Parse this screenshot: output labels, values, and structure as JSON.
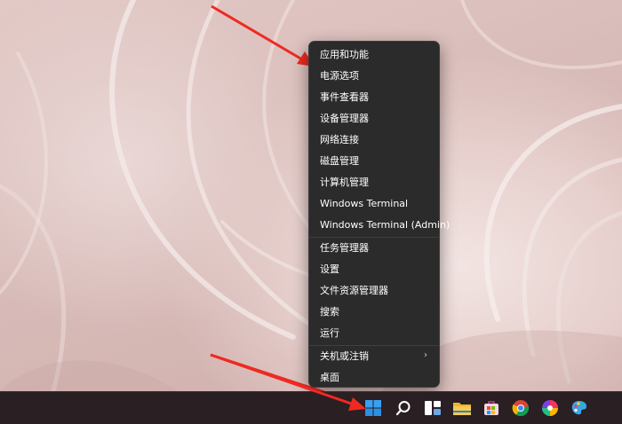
{
  "context_menu": {
    "items": [
      {
        "label": "应用和功能"
      },
      {
        "label": "电源选项"
      },
      {
        "label": "事件查看器"
      },
      {
        "label": "设备管理器"
      },
      {
        "label": "网络连接"
      },
      {
        "label": "磁盘管理"
      },
      {
        "label": "计算机管理"
      },
      {
        "label": "Windows Terminal"
      },
      {
        "label": "Windows Terminal (Admin)"
      },
      {
        "label": "任务管理器"
      },
      {
        "label": "设置"
      },
      {
        "label": "文件资源管理器"
      },
      {
        "label": "搜索"
      },
      {
        "label": "运行"
      },
      {
        "label": "关机或注销",
        "submenu_indicator": "›"
      },
      {
        "label": "桌面"
      }
    ]
  },
  "taskbar": {
    "icons": [
      "start-icon",
      "search-icon",
      "task-view-icon",
      "file-explorer-icon",
      "store-icon",
      "chrome-icon",
      "color-app-icon",
      "paint-icon"
    ]
  },
  "annotations": {
    "arrow_color": "#ee2a22"
  },
  "colors": {
    "menu_background": "#2b2b2b",
    "taskbar_background": "#2a1f22",
    "wallpaper": "#e2c9c6"
  }
}
